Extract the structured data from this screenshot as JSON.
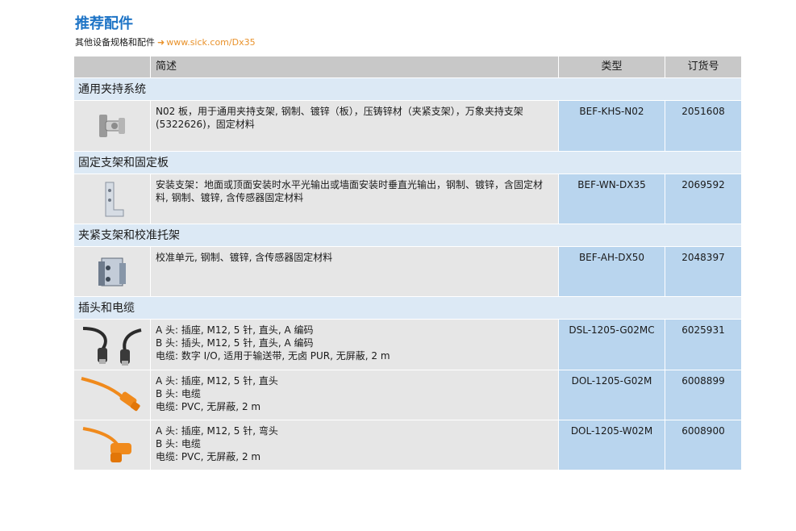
{
  "page": {
    "title": "推荐配件",
    "subtitle": "其他设备规格和配件",
    "subtitle_arrow": "➜",
    "subtitle_link": "www.sick.com/Dx35"
  },
  "table": {
    "headers": {
      "description": "简述",
      "type": "类型",
      "order_no": "订货号"
    },
    "sections": [
      {
        "label": "通用夹持系统",
        "items": [
          {
            "image": "clamp-bracket-image",
            "description": "N02 板，用于通用夹持支架, 钢制、镀锌（板），压铸锌材（夹紧支架），万象夹持支架 (5322626)，固定材料",
            "type": "BEF-KHS-N02",
            "order_no": "2051608"
          }
        ]
      },
      {
        "label": "固定支架和固定板",
        "items": [
          {
            "image": "mounting-bracket-image",
            "description": "安装支架：地面或顶面安装时水平光输出或墙面安装时垂直光输出，钢制、镀锌，含固定材料, 钢制、镀锌, 含传感器固定材料",
            "type": "BEF-WN-DX35",
            "order_no": "2069592"
          }
        ]
      },
      {
        "label": "夹紧支架和校准托架",
        "items": [
          {
            "image": "alignment-unit-image",
            "description": "校准单元, 钢制、镀锌, 含传感器固定材料",
            "type": "BEF-AH-DX50",
            "order_no": "2048397"
          }
        ]
      },
      {
        "label": "插头和电缆",
        "items": [
          {
            "image": "black-cable-image",
            "lines": [
              "A 头: 插座, M12, 5 针, 直头, A 编码",
              "B 头: 插头, M12, 5 针, 直头, A 编码",
              "电缆: 数字 I/O, 适用于输送带, 无卤 PUR, 无屏蔽, 2 m"
            ],
            "type": "DSL-1205-G02MC",
            "order_no": "6025931"
          },
          {
            "image": "orange-straight-cable-image",
            "lines": [
              "A 头: 插座, M12, 5 针, 直头",
              "B 头: 电缆",
              "电缆: PVC, 无屏蔽, 2 m"
            ],
            "type": "DOL-1205-G02M",
            "order_no": "6008899"
          },
          {
            "image": "orange-angled-cable-image",
            "lines": [
              "A 头: 插座, M12, 5 针, 弯头",
              "B 头: 电缆",
              "电缆: PVC, 无屏蔽, 2 m"
            ],
            "type": "DOL-1205-W02M",
            "order_no": "6008900"
          }
        ]
      }
    ]
  }
}
